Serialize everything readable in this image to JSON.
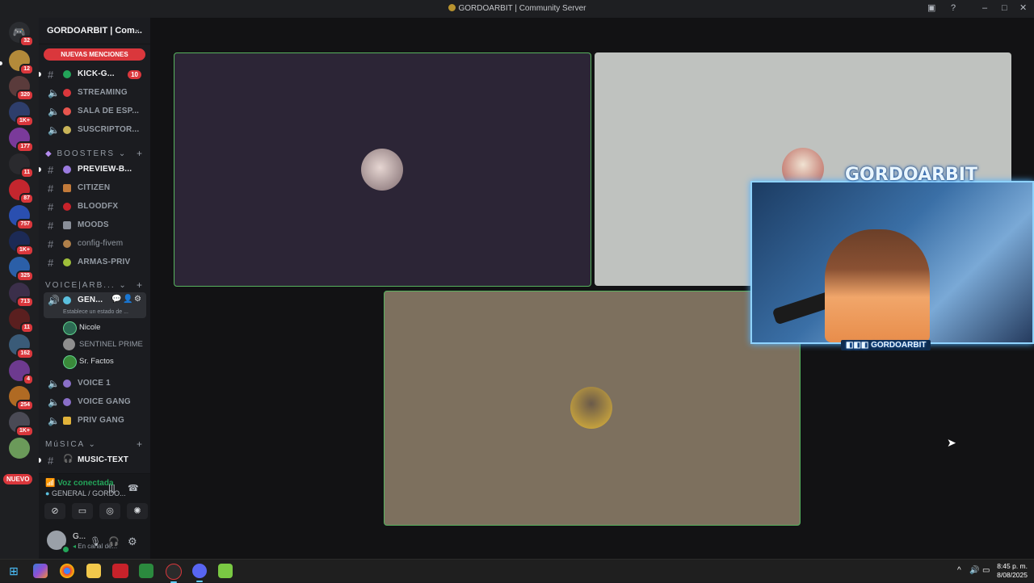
{
  "window": {
    "title": "GORDOARBIT | Community Server"
  },
  "guild_badges": [
    "32",
    "12",
    "320",
    "1K+",
    "177",
    "11",
    "87",
    "757",
    "1K+",
    "325",
    "713",
    "11",
    "162",
    "4",
    "254",
    "1K+"
  ],
  "guild_new_label": "NUEVO",
  "server": {
    "name": "GORDOARBIT | Com...",
    "mentions_banner": "NUEVAS MENCIONES"
  },
  "channels": [
    {
      "label": "KICK-G...",
      "badge": "10"
    },
    {
      "label": "STREAMING"
    },
    {
      "label": "SALA DE ESP..."
    },
    {
      "label": "SUSCRIPTOR..."
    }
  ],
  "categories": {
    "boosters": "BOOSTERS",
    "voice": "VOICE|ARB...",
    "musica": "MúSICA"
  },
  "booster_channels": [
    {
      "label": "PREVIEW-B..."
    },
    {
      "label": "CITIZEN"
    },
    {
      "label": "BLOODFX"
    },
    {
      "label": "MOODS"
    },
    {
      "label": "config-fivem"
    },
    {
      "label": "ARMAS-PRIV"
    }
  ],
  "voice_current": {
    "label": "GEN...",
    "status_hint": "Establece un estado de ..."
  },
  "voice_users": [
    {
      "name": "Nicole"
    },
    {
      "name": "SENTINEL PRIME"
    },
    {
      "name": "Sr. Factos"
    }
  ],
  "voice_channels": [
    {
      "label": "VOICE 1"
    },
    {
      "label": "VOICE GANG"
    },
    {
      "label": "PRIV GANG"
    }
  ],
  "music_channels": [
    {
      "label": "MUSIC-TEXT"
    }
  ],
  "voice_panel": {
    "status": "Voz conectada",
    "channel": "GENERAL / GORDO..."
  },
  "user": {
    "name": "G...",
    "subtitle": "En canal de..."
  },
  "stream_overlay": {
    "brand": "GORDOARBIT",
    "handle": "GORDOARBIT"
  },
  "taskbar": {
    "time": "8:45 p. m.",
    "date": "8/08/2025"
  },
  "colors": {
    "mention_red": "#da373c",
    "speaking_green": "#57b35e",
    "voice_connected": "#23a559"
  },
  "icons": [
    "discord-icon",
    "hashtag-icon",
    "speaker-icon",
    "gear-icon",
    "microphone-icon",
    "headphones-icon",
    "disconnect-icon",
    "windows-start-icon",
    "chrome-icon",
    "folder-icon"
  ]
}
